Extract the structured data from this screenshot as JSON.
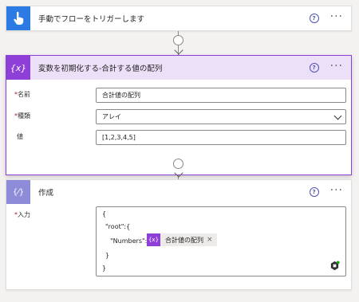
{
  "trigger": {
    "title": "手動でフローをトリガーします",
    "icon": "hand-pointer-icon",
    "color": "#2c7be5"
  },
  "init_variable": {
    "title": "変数を初期化する-合計する値の配列",
    "icon_text": "{x}",
    "color": "#8e3fd8",
    "fields": {
      "name": {
        "label": "名前",
        "required_mark": "*",
        "value": "合計値の配列"
      },
      "type": {
        "label": "種類",
        "required_mark": "*",
        "value": "アレイ"
      },
      "value": {
        "label": "値",
        "value": "[1,2,3,4,5]"
      }
    }
  },
  "compose": {
    "title": "作成",
    "icon_text": "{⁄}",
    "color": "#8e8cd8",
    "input": {
      "label": "入力",
      "required_mark": "*",
      "lines": [
        "{",
        "\"root\":{",
        "\"Numbers\":",
        "}",
        "}"
      ],
      "token": {
        "icon_text": "{x}",
        "label": "合計値の配列",
        "close": "×"
      }
    }
  },
  "common": {
    "help_glyph": "?",
    "more_glyph": "···"
  }
}
